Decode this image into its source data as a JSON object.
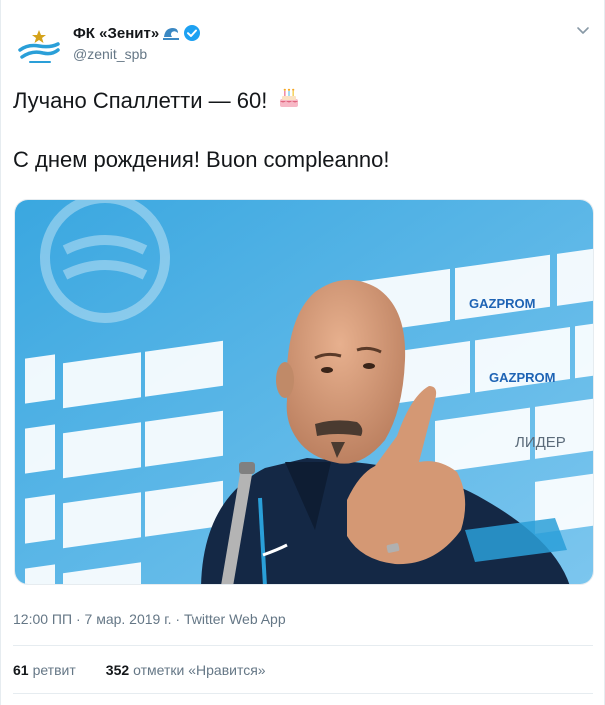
{
  "account": {
    "display_name": "ФК «Зенит»",
    "handle": "@zenit_spb",
    "avatar_icon": "zenit-logo-icon",
    "verified_icon": "verified-badge-icon",
    "wave_icon": "wave-emoji-icon"
  },
  "tweet": {
    "line1": "Лучано Спаллетти — 60!",
    "line1_emoji": "birthday-cake-icon",
    "line2": "С днем рождения! Buon compleanno!"
  },
  "media": {
    "board_brands": [
      "GAZPROM",
      "ЛИДЕР"
    ]
  },
  "meta": {
    "time": "12:00 ПП",
    "separator": "·",
    "date": "7 мар. 2019 г.",
    "source": "Twitter Web App"
  },
  "stats": {
    "retweets_count": "61",
    "retweets_label": "ретвит",
    "likes_count": "352",
    "likes_label": "отметки «Нравится»"
  },
  "colors": {
    "text": "#14171a",
    "secondary": "#657786",
    "verified": "#1da1f2",
    "border": "#e6ecf0",
    "zenit_blue": "#2a9fd8"
  }
}
